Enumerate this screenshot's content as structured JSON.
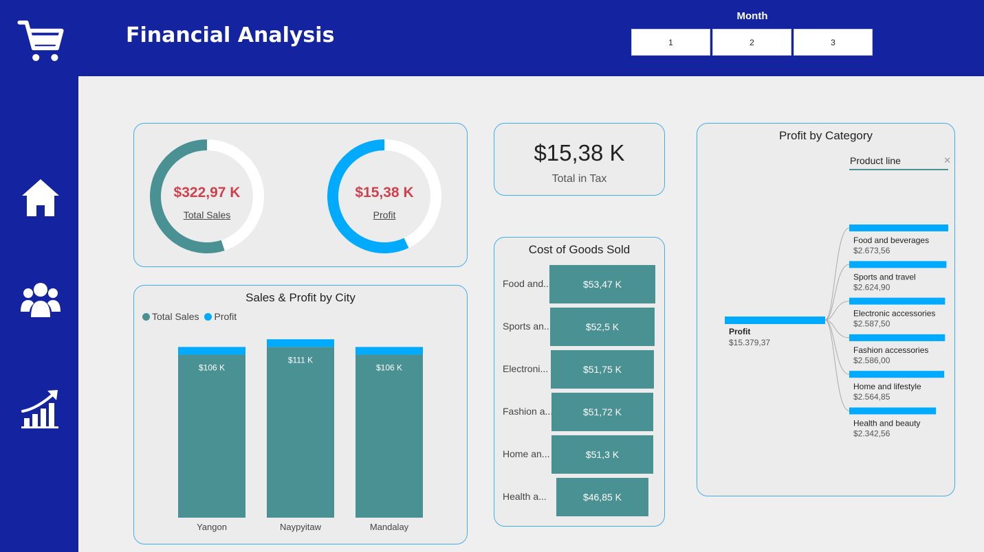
{
  "header": {
    "title": "Financial Analysis"
  },
  "month_filter": {
    "label": "Month",
    "options": [
      "1",
      "2",
      "3"
    ]
  },
  "sidebar": {
    "icons": [
      "cart-icon",
      "home-icon",
      "users-icon",
      "growth-chart-icon"
    ]
  },
  "kpis": {
    "total_sales": {
      "value": "$322,97 K",
      "label": "Total Sales",
      "fraction": 0.55
    },
    "profit": {
      "value": "$15,38 K",
      "label": "Profit",
      "fraction": 0.57
    },
    "tax": {
      "value": "$15,38 K",
      "label": "Total in Tax"
    }
  },
  "colors": {
    "sidebar": "#1423a0",
    "teal": "#4a9194",
    "blue": "#00aaff",
    "accent_red": "#d1414d",
    "border": "#42aee8"
  },
  "chart_data": [
    {
      "type": "bar",
      "title": "Sales & Profit by City",
      "categories": [
        "Yangon",
        "Naypyitaw",
        "Mandalay"
      ],
      "series": [
        {
          "name": "Total Sales",
          "values": [
            106,
            111,
            106
          ],
          "labels": [
            "$106 K",
            "$111 K",
            "$106 K"
          ],
          "color": "#4a9194"
        },
        {
          "name": "Profit",
          "values": [
            5,
            5,
            5
          ],
          "color": "#00aaff"
        }
      ],
      "ylim": [
        0,
        125
      ]
    },
    {
      "type": "bar",
      "title": "Cost of Goods Sold",
      "categories": [
        "Food and...",
        "Sports an...",
        "Electroni...",
        "Fashion a...",
        "Home an...",
        "Health a..."
      ],
      "values": [
        53.47,
        52.5,
        51.75,
        51.72,
        51.3,
        46.85
      ],
      "labels": [
        "$53,47 K",
        "$52,5 K",
        "$51,75 K",
        "$51,72 K",
        "$51,3 K",
        "$46,85 K"
      ]
    },
    {
      "type": "bar",
      "title": "Profit by Category",
      "filter": "Product line",
      "root": {
        "name": "Profit",
        "value": 15379.37,
        "label": "$15.379,37"
      },
      "categories": [
        "Food and beverages",
        "Sports and travel",
        "Electronic accessories",
        "Fashion accessories",
        "Home and lifestyle",
        "Health and beauty"
      ],
      "values": [
        2673.56,
        2624.9,
        2587.5,
        2586.0,
        2564.85,
        2342.56
      ],
      "labels": [
        "$2.673,56",
        "$2.624,90",
        "$2.587,50",
        "$2.586,00",
        "$2.564,85",
        "$2.342,56"
      ]
    }
  ]
}
